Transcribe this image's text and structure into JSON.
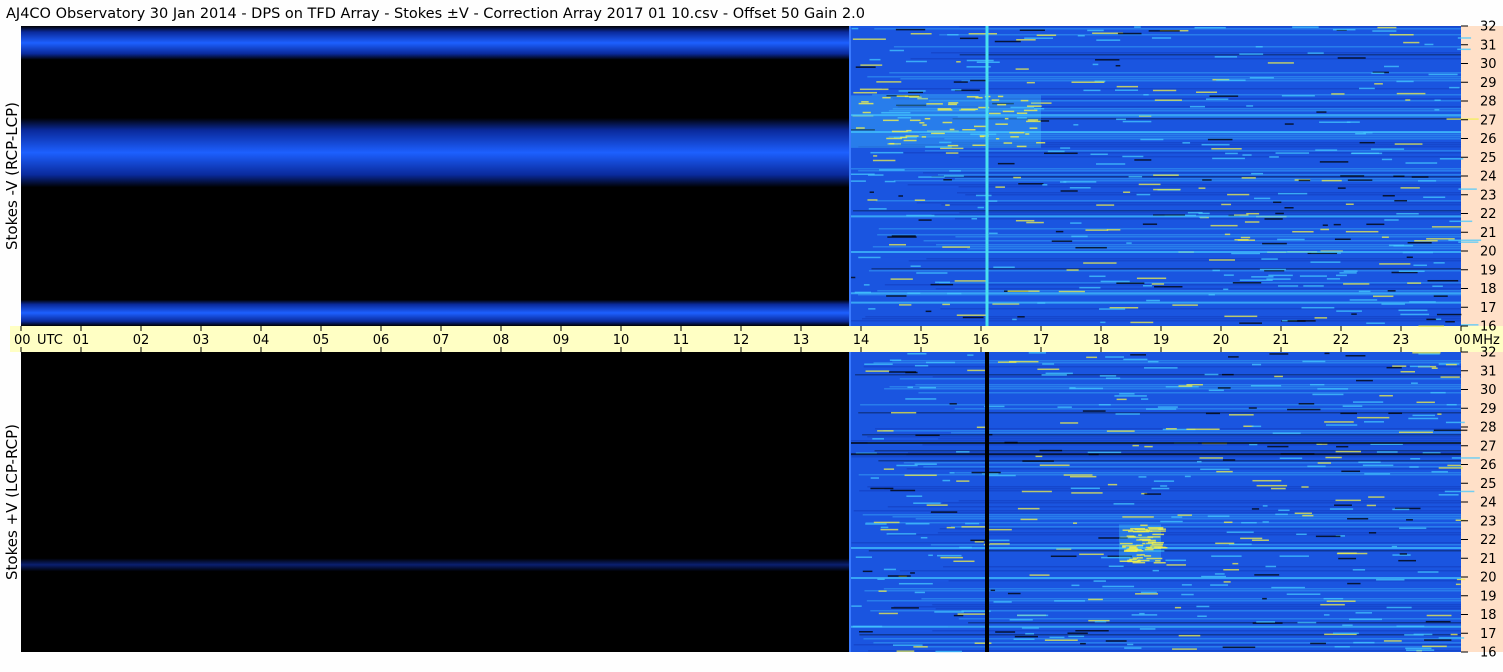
{
  "title": "AJ4CO Observatory  30 Jan 2014  -  DPS on TFD Array  -  Stokes ±V  -  Correction Array 2017 01 10.csv  -  Offset 50  Gain 2.0",
  "colors": {
    "background": "#fefefe",
    "time_strip": "#ffffc4",
    "freq_strip": "#ffe0c8",
    "no_data": "#000000",
    "spectrum_base": "#1a55e0",
    "spectrum_bright": "#44c8ff",
    "spectrum_hot": "#f2f24a",
    "spectrum_peak": "#ff7a00"
  },
  "chart_data": {
    "type": "heatmap",
    "xlabel": "UTC",
    "x_unit": "UTC",
    "y_unit": "MHz",
    "x_ticks": [
      "00",
      "01",
      "02",
      "03",
      "04",
      "05",
      "06",
      "07",
      "08",
      "09",
      "10",
      "11",
      "12",
      "13",
      "14",
      "15",
      "16",
      "17",
      "18",
      "19",
      "20",
      "21",
      "22",
      "23",
      "00"
    ],
    "xlim": [
      0,
      24
    ],
    "ylim": [
      16,
      32
    ],
    "y_ticks": [
      32,
      31,
      30,
      29,
      28,
      27,
      26,
      25,
      24,
      23,
      22,
      21,
      20,
      19,
      18,
      17,
      16
    ],
    "data_start_utc": 13.8,
    "panels": [
      {
        "ylabel": "Stokes -V (RCP-LCP)",
        "pre_data_bands_mhz": [
          [
            30.2,
            32
          ],
          [
            23.4,
            27.1
          ],
          [
            16,
            17.4
          ]
        ],
        "bright_horizontal_lines_mhz": [
          27.3,
          26.4,
          21.9,
          20.0,
          17.8,
          17.3
        ],
        "bright_vertical_line_utc": 16.1,
        "activity_region": {
          "utc": [
            13.8,
            17.0
          ],
          "mhz": [
            25.5,
            28.3
          ]
        }
      },
      {
        "ylabel": "Stokes +V (LCP-RCP)",
        "pre_data_bands_mhz": [
          [
            20.3,
            21.0
          ]
        ],
        "dark_vertical_line_utc": 16.1,
        "dark_horizontal_lines_mhz": [
          27.2,
          26.6
        ],
        "bright_horizontal_lines_mhz": [
          21.6,
          20.0,
          17.4
        ],
        "activity_region": {
          "utc": [
            18.3,
            19.0
          ],
          "mhz": [
            20.8,
            22.8
          ]
        }
      }
    ]
  }
}
